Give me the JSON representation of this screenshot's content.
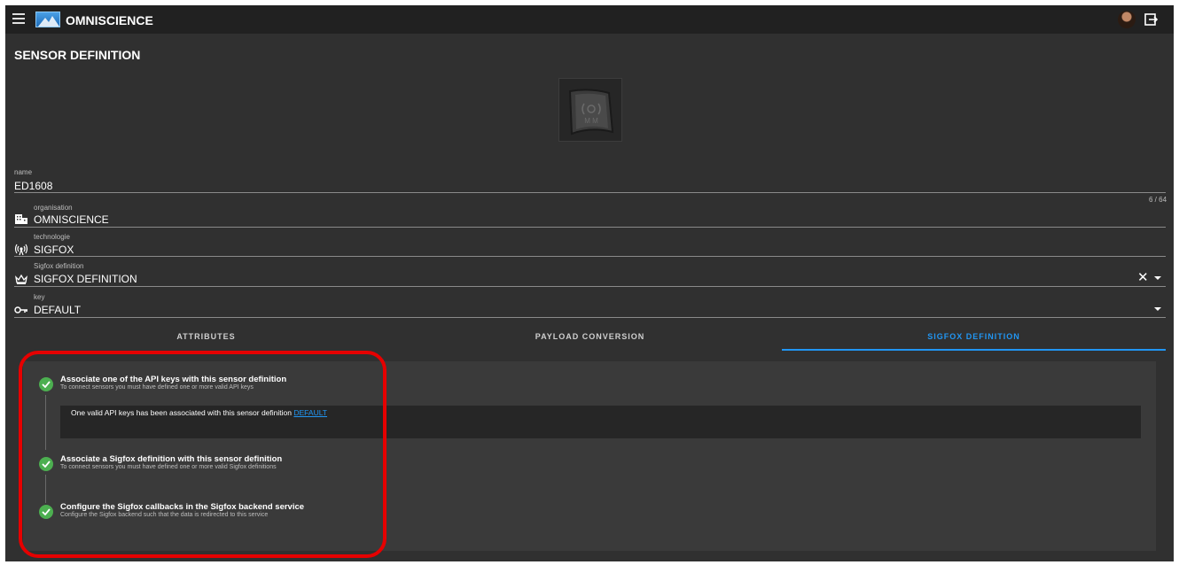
{
  "app": {
    "title": "OMNISCIENCE"
  },
  "page": {
    "title": "SENSOR DEFINITION"
  },
  "form": {
    "name": {
      "label": "name",
      "value": "ED1608",
      "counter": "6 / 64"
    },
    "organisation": {
      "label": "organisation",
      "value": "OMNISCIENCE"
    },
    "technologie": {
      "label": "technologie",
      "value": "SIGFOX"
    },
    "sigfox_definition": {
      "label": "Sigfox definition",
      "value": "SIGFOX DEFINITION",
      "clear": "✕"
    },
    "key": {
      "label": "key",
      "value": "DEFAULT"
    }
  },
  "tabs": [
    {
      "label": "ATTRIBUTES",
      "active": false
    },
    {
      "label": "PAYLOAD CONVERSION",
      "active": false
    },
    {
      "label": "SIGFOX DEFINITION",
      "active": true
    }
  ],
  "steps": [
    {
      "title": "Associate one of the API keys with this sensor definition",
      "subtitle": "To connect sensors you must have defined one or more valid API keys",
      "content_text": "One valid API keys has been associated with this sensor definition ",
      "content_link": "DEFAULT",
      "done": true
    },
    {
      "title": "Associate a Sigfox definition with this sensor definition",
      "subtitle": "To connect sensors you must have defined one or more valid Sigfox definitions",
      "done": true
    },
    {
      "title": "Configure the Sigfox callbacks in the Sigfox backend service",
      "subtitle": "Configure the Sigfox backend such that the data is redirected to this service",
      "done": true
    }
  ],
  "icons": {
    "menu": "menu-icon",
    "logo": "omniscience-logo",
    "avatar": "user-avatar",
    "logout": "logout-icon",
    "organisation": "building-icon",
    "technologie": "radio-tower-icon",
    "sigfox_definition": "crown-icon",
    "key": "key-icon",
    "step_done": "check-circle-icon"
  },
  "colors": {
    "accent": "#2196f3",
    "success": "#4caf50",
    "annotation": "#e60000",
    "background": "#303030",
    "topbar": "#212121"
  }
}
